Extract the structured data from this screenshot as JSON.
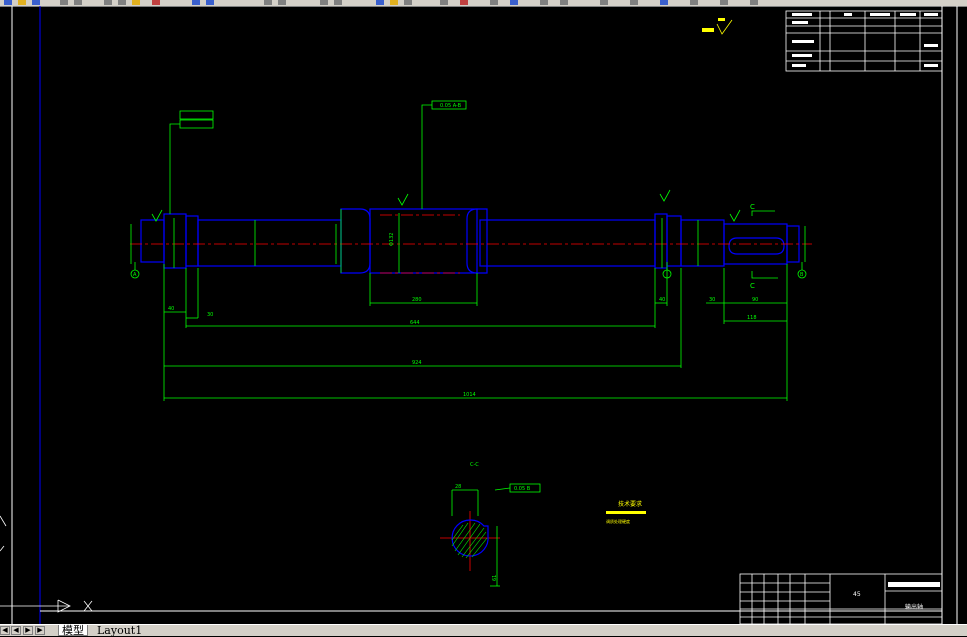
{
  "tabs": [
    {
      "label": "模型",
      "active": true
    },
    {
      "label": "Layout1",
      "active": false
    }
  ],
  "nav_icons": [
    "first-icon",
    "prev-icon",
    "next-icon",
    "last-icon"
  ],
  "colors": {
    "background": "#000000",
    "geometry": "#0000ff",
    "dimension": "#00ff00",
    "centerline": "#ff0000",
    "frame": "#ffffff",
    "note": "#ffff00"
  },
  "drawing": {
    "dimensions": {
      "key_length": "90",
      "key_offset": "30",
      "shoulder_len": "30",
      "left_end": "40",
      "mid_span": "644",
      "gear_width": "280",
      "right_end": "40",
      "key_total": "118",
      "overall_1": "924",
      "overall_2": "1014"
    },
    "labels": {
      "section_id": "C-C",
      "section_marker_top": "C",
      "section_marker_bottom": "C",
      "datum_a": "A",
      "datum_b": "B",
      "tech_req_title": "技术要求",
      "tech_req_line": "调质处理硬度",
      "roughness_label": "其余",
      "roughness_value": "12.5",
      "gear_note": "Φ132",
      "runout_frame": "0.05 A-B",
      "section_tol": "0.05 B",
      "section_keywidth": "28",
      "section_depth": "61"
    },
    "title_block": {
      "material": "45",
      "part_name": "输出轴"
    }
  }
}
